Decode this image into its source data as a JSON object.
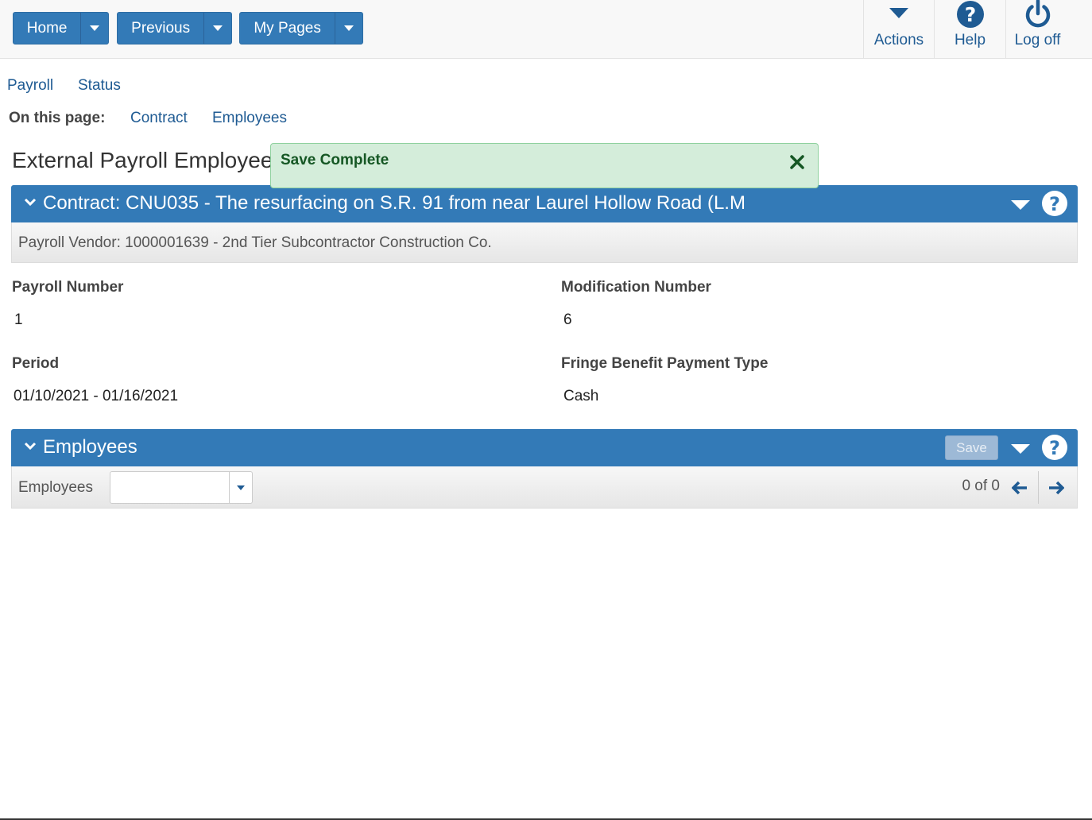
{
  "nav": {
    "home_label": "Home",
    "previous_label": "Previous",
    "mypages_label": "My Pages"
  },
  "toolbar": {
    "actions_label": "Actions",
    "help_label": "Help",
    "logoff_label": "Log off"
  },
  "breadcrumb": {
    "payroll": "Payroll",
    "status": "Status"
  },
  "on_this_page": {
    "label": "On this page:",
    "contract": "Contract",
    "employees": "Employees"
  },
  "page": {
    "title": "External Payroll Employees"
  },
  "toast": {
    "message": "Save Complete"
  },
  "contract_panel": {
    "title": "Contract: CNU035 - The resurfacing on S.R. 91 from near Laurel Hollow Road (L.M",
    "vendor": "Payroll Vendor: 1000001639 - 2nd Tier Subcontractor Construction Co."
  },
  "fields": {
    "payroll_number_label": "Payroll Number",
    "payroll_number": "1",
    "modification_number_label": "Modification Number",
    "modification_number": "6",
    "period_label": "Period",
    "period": "01/10/2021 - 01/16/2021",
    "fringe_label": "Fringe Benefit Payment Type",
    "fringe": "Cash"
  },
  "employees_panel": {
    "title": "Employees",
    "save_label": "Save",
    "selector_label": "Employees",
    "selector_value": "",
    "pager": "0 of 0"
  },
  "colors": {
    "primary": "#337ab7",
    "link": "#1f5b93",
    "success_bg": "#d4edda",
    "success_text": "#155724"
  }
}
